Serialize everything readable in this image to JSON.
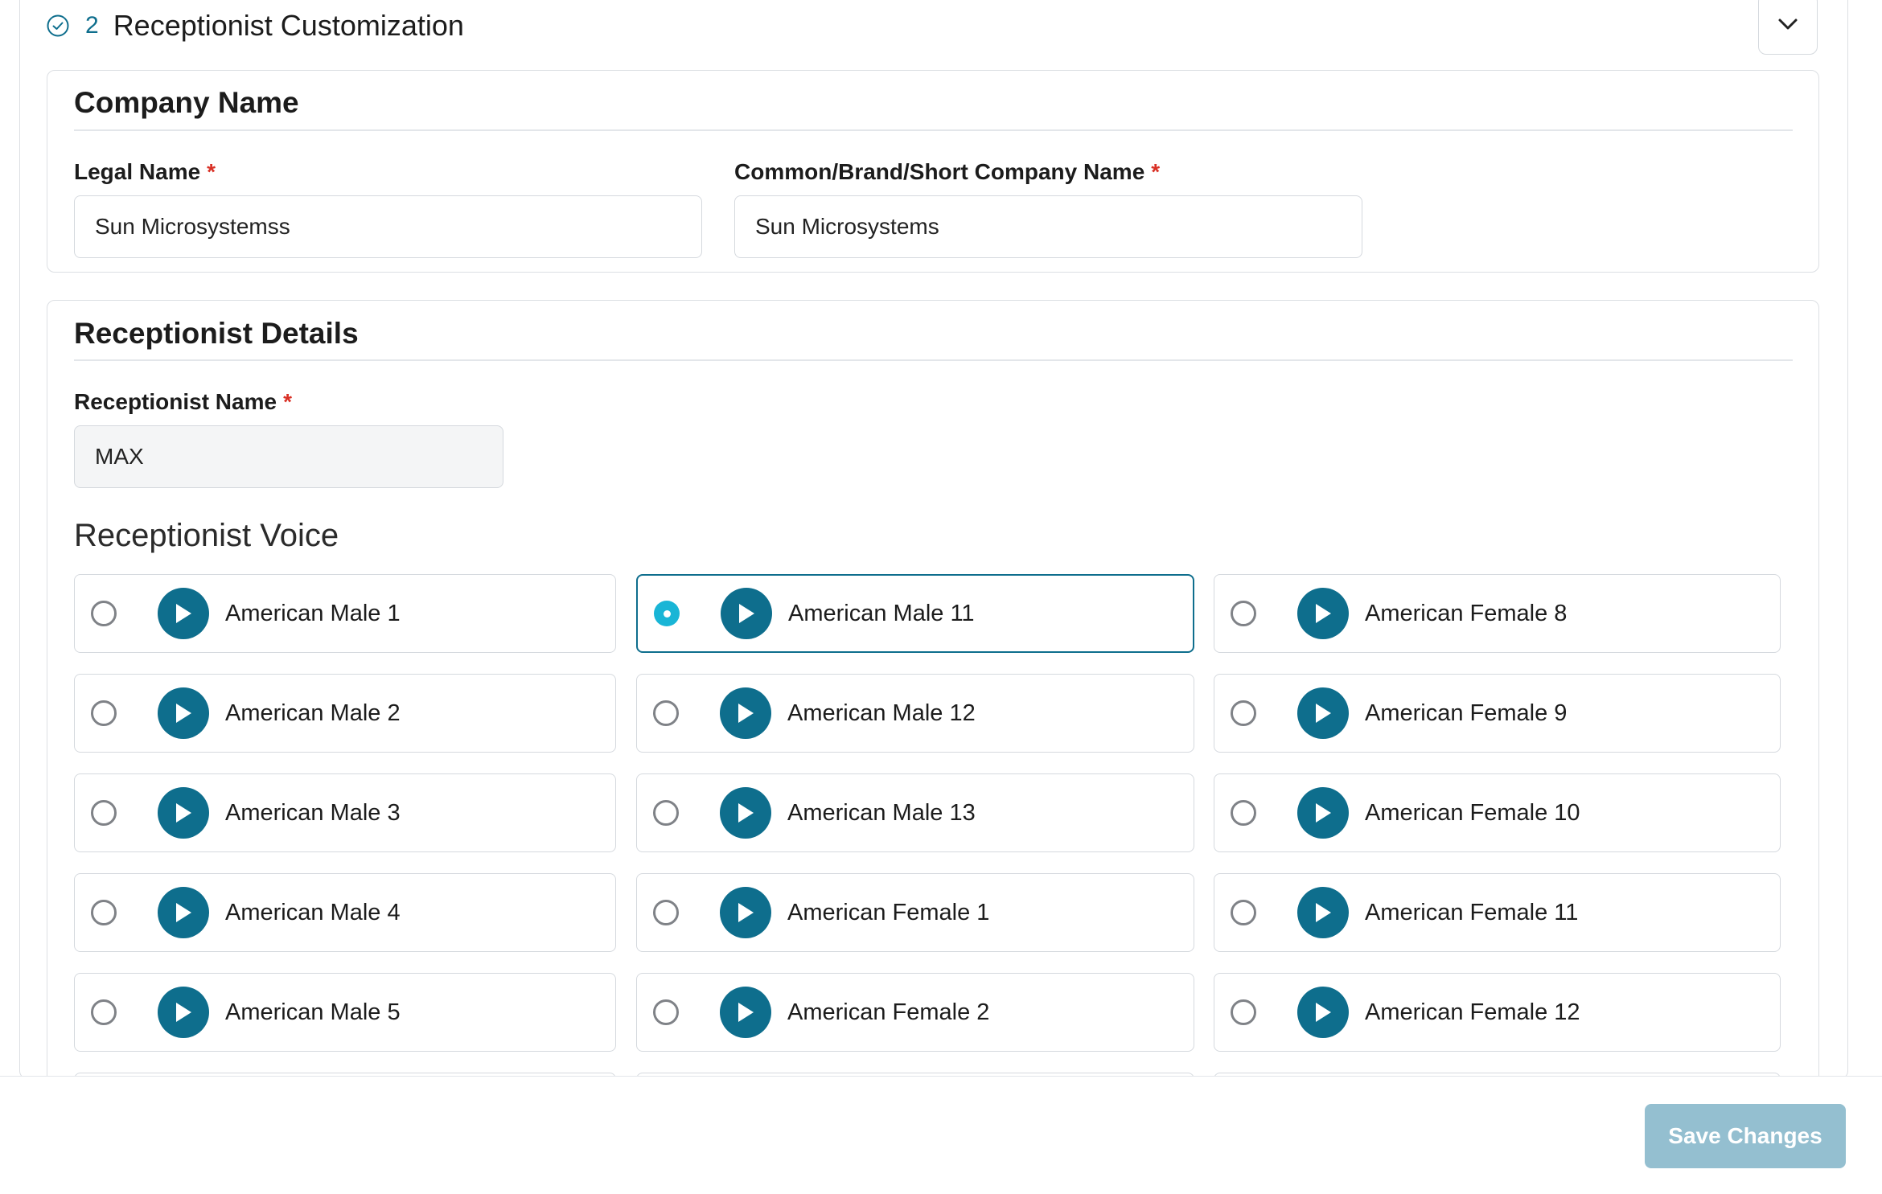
{
  "step": {
    "number": "2",
    "title": "Receptionist Customization"
  },
  "company_section": {
    "title": "Company Name",
    "legal_name_label": "Legal Name",
    "legal_name_value": "Sun Microsystemss",
    "brand_name_label": "Common/Brand/Short Company Name",
    "brand_name_value": "Sun Microsystems",
    "required_mark": "*"
  },
  "receptionist_section": {
    "title": "Receptionist Details",
    "name_label": "Receptionist Name",
    "name_value": "MAX",
    "required_mark": "*",
    "voice_heading": "Receptionist Voice"
  },
  "voices": {
    "columns": [
      [
        {
          "label": "American Male 1",
          "selected": false
        },
        {
          "label": "American Male 2",
          "selected": false
        },
        {
          "label": "American Male 3",
          "selected": false
        },
        {
          "label": "American Male 4",
          "selected": false
        },
        {
          "label": "American Male 5",
          "selected": false
        }
      ],
      [
        {
          "label": "American Male 11",
          "selected": true
        },
        {
          "label": "American Male 12",
          "selected": false
        },
        {
          "label": "American Male 13",
          "selected": false
        },
        {
          "label": "American Female 1",
          "selected": false
        },
        {
          "label": "American Female 2",
          "selected": false
        }
      ],
      [
        {
          "label": "American Female 8",
          "selected": false
        },
        {
          "label": "American Female 9",
          "selected": false
        },
        {
          "label": "American Female 10",
          "selected": false
        },
        {
          "label": "American Female 11",
          "selected": false
        },
        {
          "label": "American Female 12",
          "selected": false
        }
      ]
    ]
  },
  "footer": {
    "save_label": "Save Changes"
  },
  "colors": {
    "accent": "#0e6e8d",
    "radio_selected": "#19b5d6",
    "save_disabled": "#94bfd0",
    "required": "#d93025"
  },
  "icons": {
    "step_status": "check-circle-icon",
    "collapse": "chevron-down-icon",
    "play": "play-icon"
  }
}
